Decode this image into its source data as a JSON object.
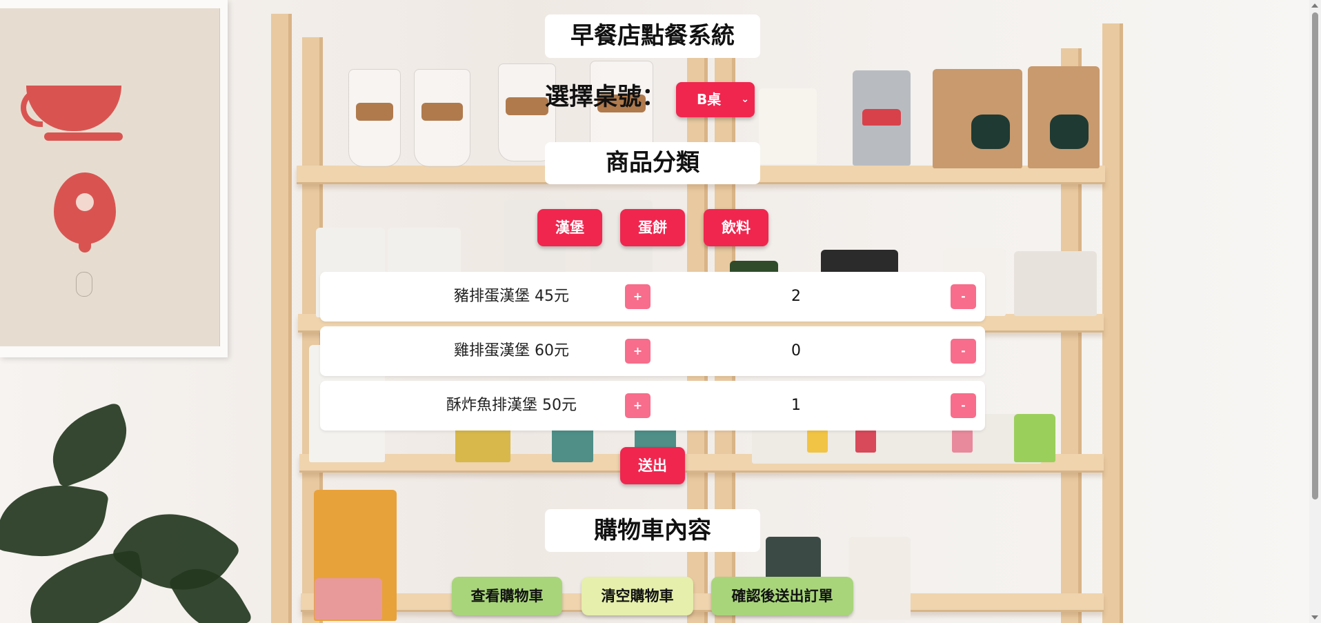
{
  "app": {
    "title": "早餐店點餐系統"
  },
  "table_selector": {
    "label": "選擇桌號：",
    "selected": "B桌"
  },
  "categories": {
    "title": "商品分類",
    "items": [
      {
        "label": "漢堡"
      },
      {
        "label": "蛋餅"
      },
      {
        "label": "飲料"
      }
    ]
  },
  "products": [
    {
      "name": "豬排蛋漢堡 45元",
      "qty": "2",
      "plus": "+",
      "minus": "-"
    },
    {
      "name": "雞排蛋漢堡 60元",
      "qty": "0",
      "plus": "+",
      "minus": "-"
    },
    {
      "name": "酥炸魚排漢堡 50元",
      "qty": "1",
      "plus": "+",
      "minus": "-"
    }
  ],
  "send_label": "送出",
  "cart": {
    "title": "購物車內容",
    "buttons": [
      {
        "label": "查看購物車",
        "color": "#a8d57a"
      },
      {
        "label": "清空購物車",
        "color": "#e6efab"
      },
      {
        "label": "確認後送出訂單",
        "color": "#a8d57a"
      }
    ]
  },
  "colors": {
    "primary": "#f0264f",
    "qty_button": "#f76d8b"
  },
  "icons": {
    "select_arrow": "chevron-down-icon"
  }
}
